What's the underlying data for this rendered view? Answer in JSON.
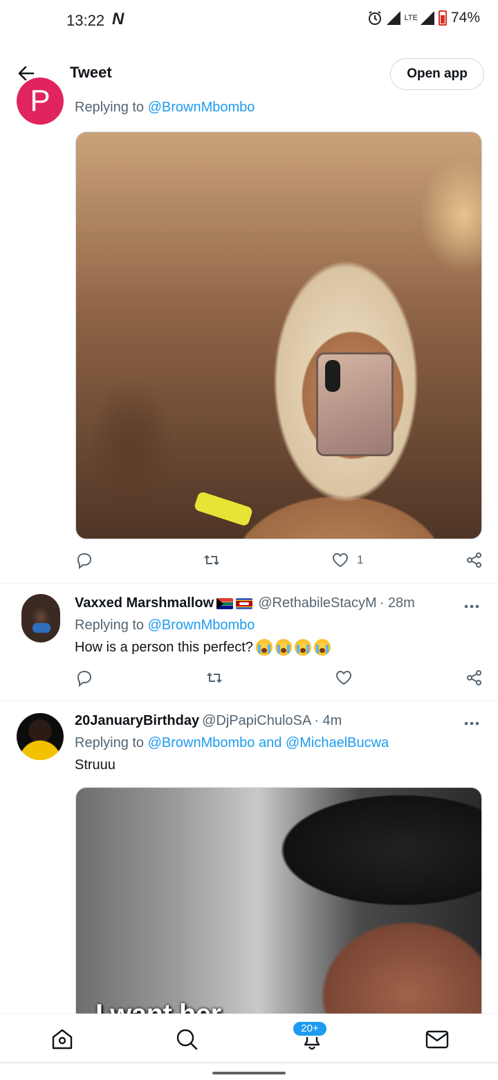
{
  "status_bar": {
    "time": "13:22",
    "carrier_icon": "N",
    "lte": "LTE",
    "battery": "74%"
  },
  "header": {
    "title": "Tweet",
    "open_app": "Open app"
  },
  "tweet1": {
    "avatar_letter": "P",
    "replying_prefix": "Replying to",
    "replying_to": "@BrownMbombo",
    "like_count": "1"
  },
  "tweet2": {
    "name": "Vaxxed Marshmallow",
    "handle": "@RethabileStacyM",
    "time": "· 28m",
    "replying_prefix": "Replying to",
    "replying_to": "@BrownMbombo",
    "text": "How is a person this perfect?"
  },
  "tweet3": {
    "name": "20JanuaryBirthday",
    "handle": "@DjPapiChuloSA",
    "time": "· 4m",
    "replying_prefix": "Replying to",
    "replying_to": "@BrownMbombo and @MichaelBucwa",
    "text": "Struuu",
    "media_caption": "I want her"
  },
  "bottom_nav": {
    "notifications_badge": "20+"
  },
  "colors": {
    "accent": "#1d9bf0",
    "text_primary": "#0f1419",
    "text_secondary": "#536471",
    "avatar_p": "#e0245e"
  }
}
